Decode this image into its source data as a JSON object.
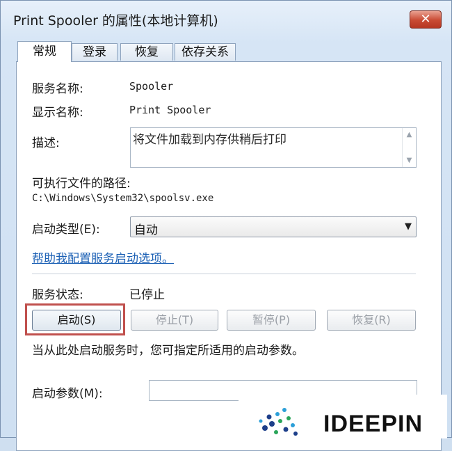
{
  "window": {
    "title": "Print Spooler 的属性(本地计算机)",
    "close_label": "✕"
  },
  "tabs": [
    {
      "label": "常规",
      "active": true
    },
    {
      "label": "登录",
      "active": false
    },
    {
      "label": "恢复",
      "active": false
    },
    {
      "label": "依存关系",
      "active": false
    }
  ],
  "general": {
    "service_name_label": "服务名称:",
    "service_name_value": "Spooler",
    "display_name_label": "显示名称:",
    "display_name_value": "Print Spooler",
    "description_label": "描述:",
    "description_value": "将文件加载到内存供稍后打印",
    "exe_path_label": "可执行文件的路径:",
    "exe_path_value": "C:\\Windows\\System32\\spoolsv.exe",
    "startup_type_label": "启动类型(E):",
    "startup_type_value": "自动",
    "help_link": "帮助我配置服务启动选项。",
    "status_label": "服务状态:",
    "status_value": "已停止",
    "hint_text": "当从此处启动服务时，您可指定所适用的启动参数。",
    "start_params_label": "启动参数(M):",
    "start_params_value": ""
  },
  "buttons": {
    "start": "启动(S)",
    "stop": "停止(T)",
    "pause": "暂停(P)",
    "resume": "恢复(R)"
  },
  "watermark": {
    "brand_text": "IDEEPIN"
  },
  "colors": {
    "highlight_box": "#c0504d",
    "link": "#1a5fb4",
    "close_button": "#c94a33"
  }
}
